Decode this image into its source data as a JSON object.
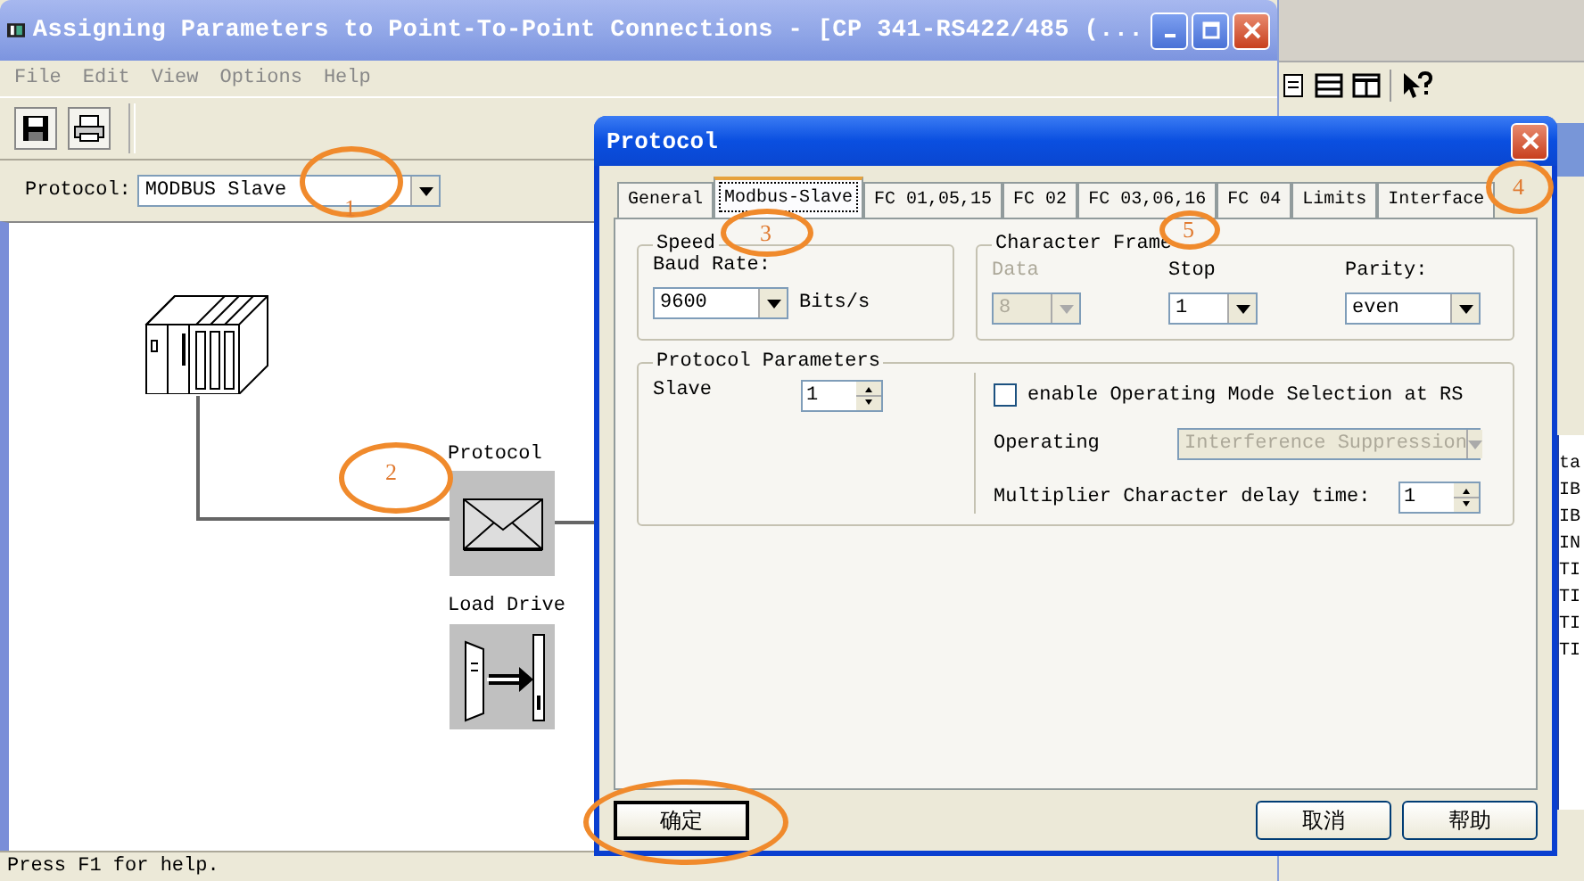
{
  "main_window": {
    "title": "Assigning Parameters to Point-To-Point Connections - [CP 341-RS422/485  (...",
    "menu": [
      "File",
      "Edit",
      "View",
      "Options",
      "Help"
    ],
    "protocol_label": "Protocol:",
    "protocol_value": "MODBUS Slave",
    "diagram": {
      "protocol_label": "Protocol",
      "load_driver_label": "Load Drive"
    },
    "status_bar": "Press F1 for help."
  },
  "background_window": {
    "list_fragments": [
      "ta",
      "IB",
      "IB",
      "IN",
      "TI",
      "TI",
      "TI",
      "TI"
    ]
  },
  "dialog": {
    "title": "Protocol",
    "tabs": [
      {
        "label": "General",
        "selected": false
      },
      {
        "label": "Modbus-Slave",
        "selected": true
      },
      {
        "label": "FC 01,05,15",
        "selected": false
      },
      {
        "label": "FC 02",
        "selected": false
      },
      {
        "label": "FC 03,06,16",
        "selected": false
      },
      {
        "label": "FC 04",
        "selected": false
      },
      {
        "label": "Limits",
        "selected": false
      },
      {
        "label": "Interface",
        "selected": false
      }
    ],
    "speed": {
      "title": "Speed",
      "baud_label": "Baud Rate:",
      "baud_value": "9600",
      "unit": "Bits/s"
    },
    "character_frame": {
      "title": "Character Frame",
      "fields": [
        {
          "label": "Data",
          "value": "8",
          "disabled": true
        },
        {
          "label": "Stop",
          "value": "1",
          "disabled": false
        },
        {
          "label": "Parity:",
          "value": "even",
          "disabled": false
        }
      ]
    },
    "protocol_parameters": {
      "title": "Protocol Parameters",
      "slave_label": "Slave",
      "slave_value": "1",
      "checkbox": {
        "label": "enable Operating Mode Selection at RS",
        "checked": false
      },
      "operating_label": "Operating",
      "operating_value": "Interference Suppression",
      "operating_disabled": true,
      "multiplier_label": "Multiplier Character delay time:",
      "multiplier_value": "1"
    },
    "buttons": [
      "确定",
      "取消",
      "帮助"
    ]
  },
  "annotations": [
    {
      "kind": "ellipse",
      "label": "1"
    },
    {
      "kind": "ellipse",
      "label": "2"
    },
    {
      "kind": "ellipse",
      "label": "3"
    },
    {
      "kind": "ellipse",
      "label": "4"
    },
    {
      "kind": "ellipse",
      "label": "5"
    },
    {
      "kind": "ellipse"
    }
  ]
}
